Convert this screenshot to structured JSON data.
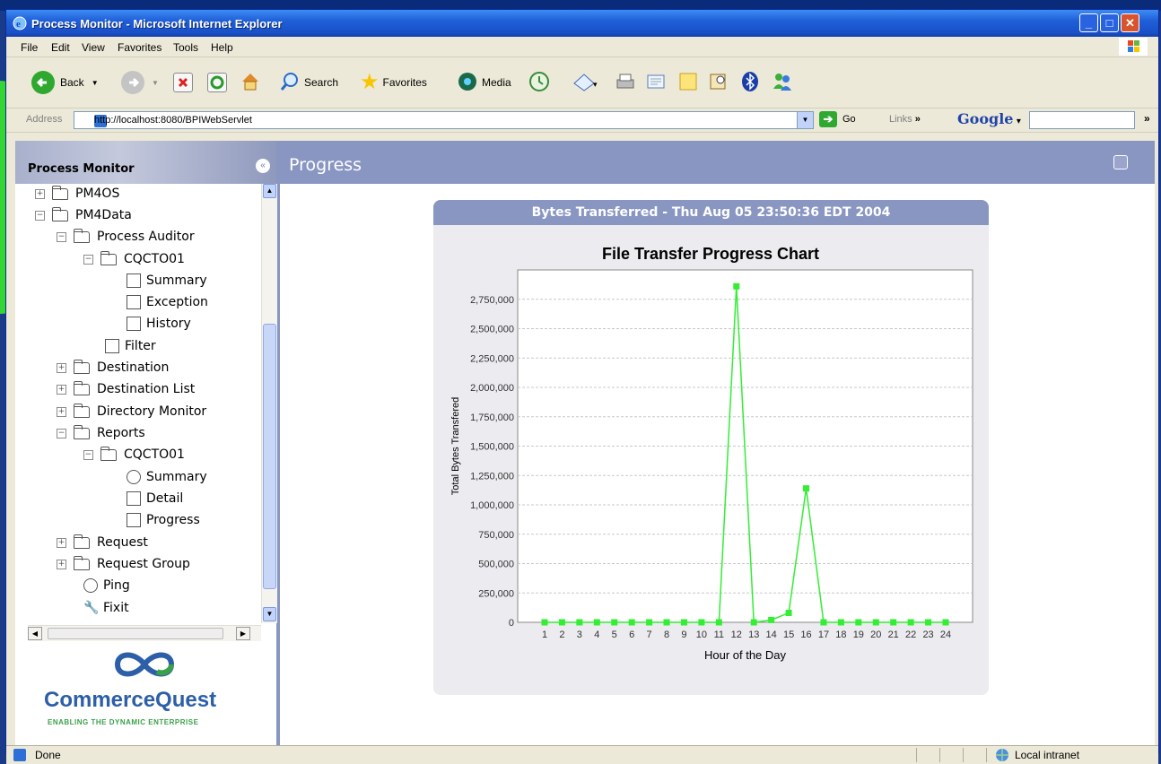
{
  "window": {
    "title": "Process Monitor - Microsoft Internet Explorer"
  },
  "menu": [
    "File",
    "Edit",
    "View",
    "Favorites",
    "Tools",
    "Help"
  ],
  "toolbar": {
    "back_label": "Back",
    "search_label": "Search",
    "favorites_label": "Favorites",
    "media_label": "Media"
  },
  "address": {
    "label": "Address",
    "url": "http://localhost:8080/BPIWebServlet",
    "go_label": "Go",
    "links_label": "Links",
    "google_label": "Google"
  },
  "left_panel": {
    "title": "Process Monitor",
    "tree": [
      {
        "label": "PM4OS"
      },
      {
        "label": "PM4Data"
      },
      {
        "label": "Process Auditor"
      },
      {
        "label": "CQCTO01"
      },
      {
        "label": "Summary"
      },
      {
        "label": "Exception"
      },
      {
        "label": "History"
      },
      {
        "label": "Filter"
      },
      {
        "label": "Destination"
      },
      {
        "label": "Destination List"
      },
      {
        "label": "Directory Monitor"
      },
      {
        "label": "Reports"
      },
      {
        "label": "CQCTO01"
      },
      {
        "label": "Summary"
      },
      {
        "label": "Detail"
      },
      {
        "label": "Progress"
      },
      {
        "label": "Request"
      },
      {
        "label": "Request Group"
      },
      {
        "label": "Ping"
      },
      {
        "label": "Fixit"
      }
    ],
    "logo": {
      "name": "CommerceQuest",
      "tagline": "ENABLING THE DYNAMIC ENTERPRISE"
    }
  },
  "main": {
    "title": "Progress",
    "panel_header": "Bytes Transferred - Thu Aug 05 23:50:36 EDT 2004"
  },
  "chart_data": {
    "type": "line",
    "title": "File Transfer Progress Chart",
    "xlabel": "Hour of the Day",
    "ylabel": "Total Bytes Transfered",
    "x": [
      1,
      2,
      3,
      4,
      5,
      6,
      7,
      8,
      9,
      10,
      11,
      12,
      13,
      14,
      15,
      16,
      17,
      18,
      19,
      20,
      21,
      22,
      23,
      24
    ],
    "values": [
      0,
      0,
      0,
      0,
      0,
      0,
      0,
      0,
      0,
      0,
      0,
      2860000,
      0,
      20000,
      80000,
      1140000,
      0,
      0,
      0,
      0,
      0,
      0,
      0,
      0
    ],
    "yticks": [
      "0",
      "250,000",
      "500,000",
      "750,000",
      "1,000,000",
      "1,250,000",
      "1,500,000",
      "1,750,000",
      "2,000,000",
      "2,250,000",
      "2,500,000",
      "2,750,000"
    ],
    "ylim": [
      0,
      3000000
    ],
    "grid": true,
    "color": "#33ee33"
  },
  "status": {
    "text": "Done",
    "zone": "Local intranet"
  }
}
